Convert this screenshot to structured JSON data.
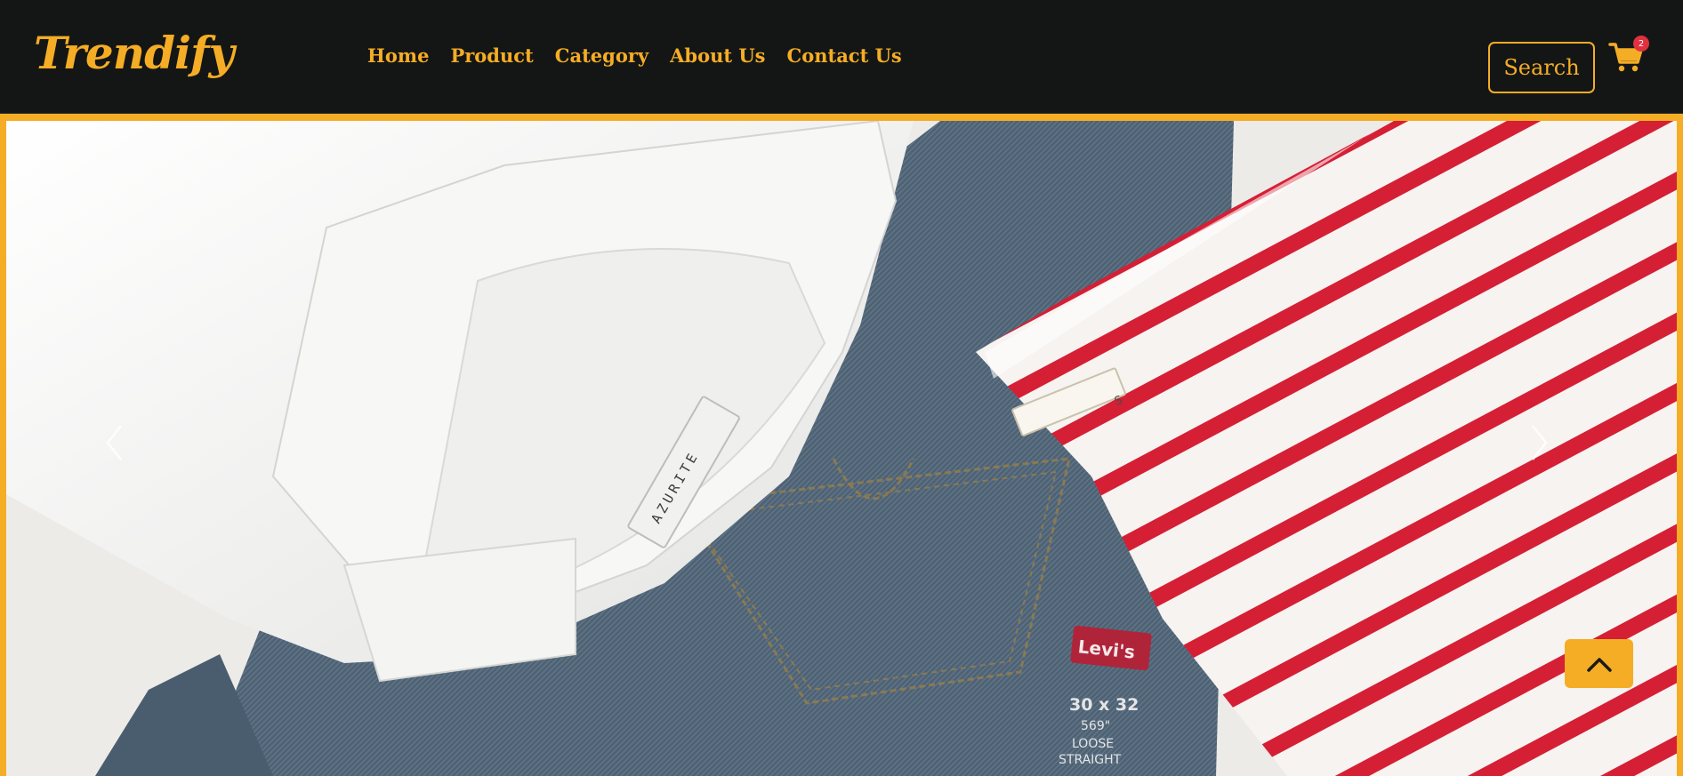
{
  "brand": {
    "name": "Trendify",
    "color": "#f5ad25"
  },
  "nav": {
    "links": [
      {
        "label": "Home"
      },
      {
        "label": "Product"
      },
      {
        "label": "Category"
      },
      {
        "label": "About Us"
      },
      {
        "label": "Contact Us"
      }
    ]
  },
  "search": {
    "label": "Search"
  },
  "cart": {
    "icon": "cart-icon",
    "count": "2"
  },
  "hero": {
    "label_tag_text": "AZURITE",
    "jeans_brand": "Levi's",
    "jeans_size_text": [
      "30 x 32",
      "569",
      "LOOSE",
      "STRAIGHT"
    ],
    "shirt_size": "S",
    "prev_icon": "chevron-left-icon",
    "next_icon": "chevron-right-icon"
  },
  "back_to_top": {
    "icon": "chevron-up-icon"
  },
  "colors": {
    "accent": "#f5ad25",
    "navbar_bg": "#141616",
    "badge": "#e0313f"
  }
}
